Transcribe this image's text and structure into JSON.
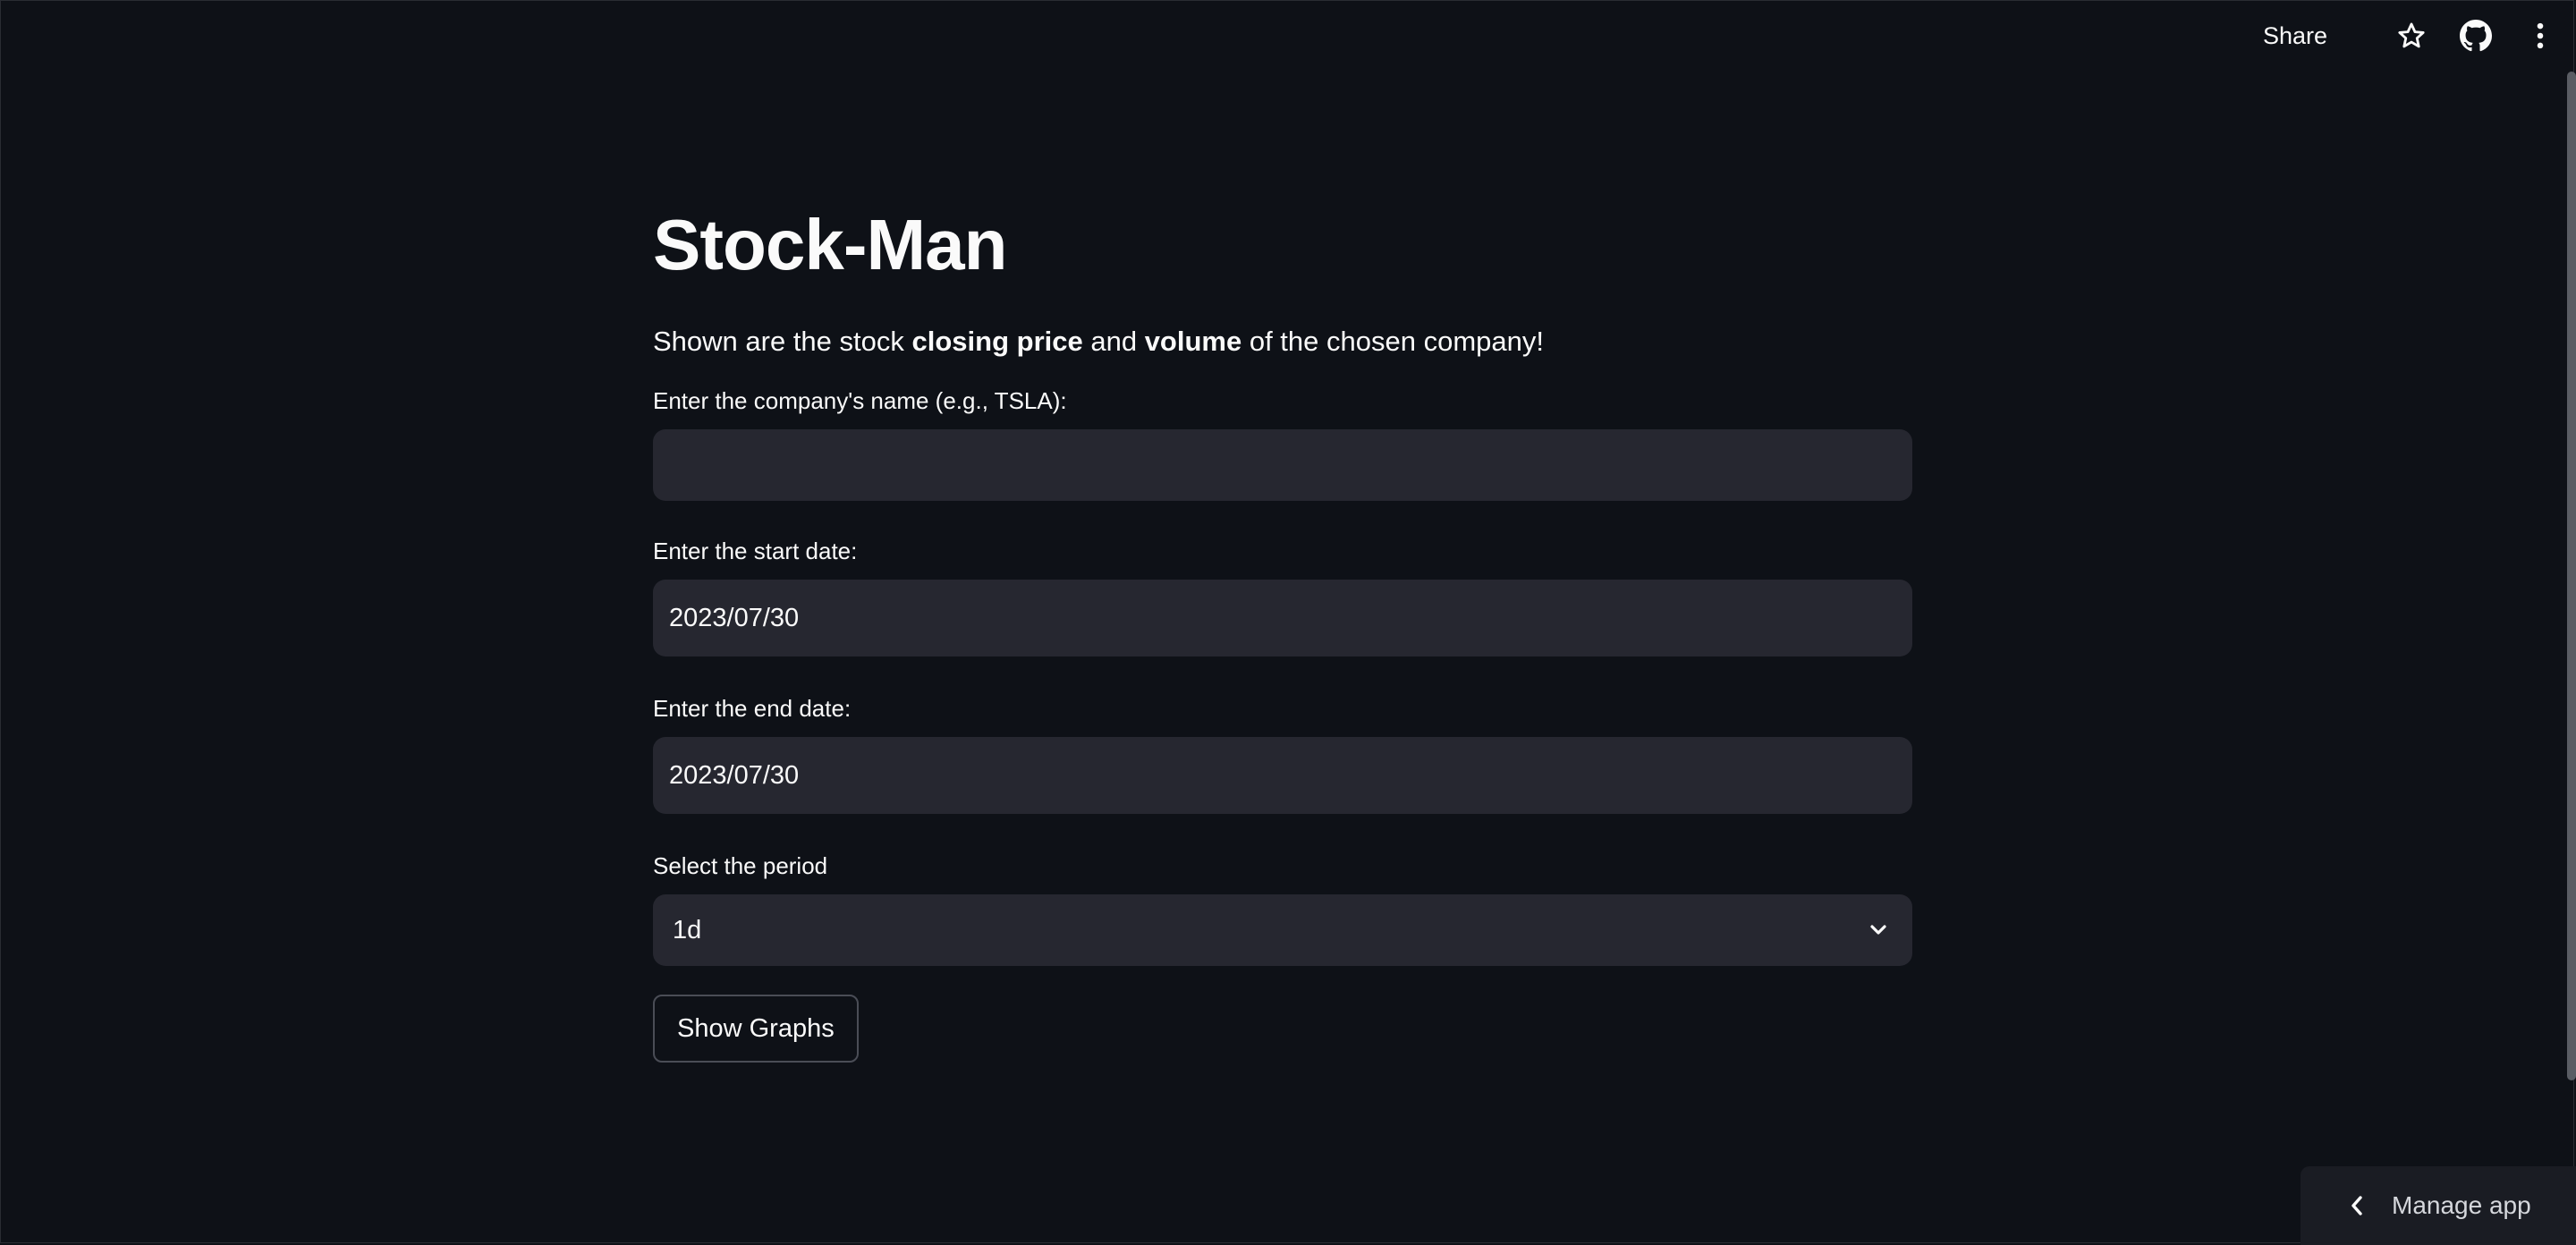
{
  "toolbar": {
    "share_label": "Share",
    "icons": [
      "star-icon",
      "github-icon",
      "more-vertical-icon"
    ]
  },
  "main": {
    "title": "Stock-Man",
    "subtitle": {
      "part1": "Shown are the stock ",
      "bold1": "closing price",
      "part2": " and ",
      "bold2": "volume",
      "part3": " of the chosen company!"
    },
    "company_field": {
      "label": "Enter the company's name (e.g., TSLA):",
      "value": "",
      "placeholder": ""
    },
    "start_date_field": {
      "label": "Enter the start date:",
      "value": "2023/07/30"
    },
    "end_date_field": {
      "label": "Enter the end date:",
      "value": "2023/07/30"
    },
    "period_select": {
      "label": "Select the period",
      "selected": "1d"
    },
    "show_button_label": "Show Graphs"
  },
  "manage_app": {
    "label": "Manage app"
  },
  "colors": {
    "background": "#0e1117",
    "input_bg": "#262730",
    "text": "#fafafa",
    "button_border": "#4a4d56"
  }
}
